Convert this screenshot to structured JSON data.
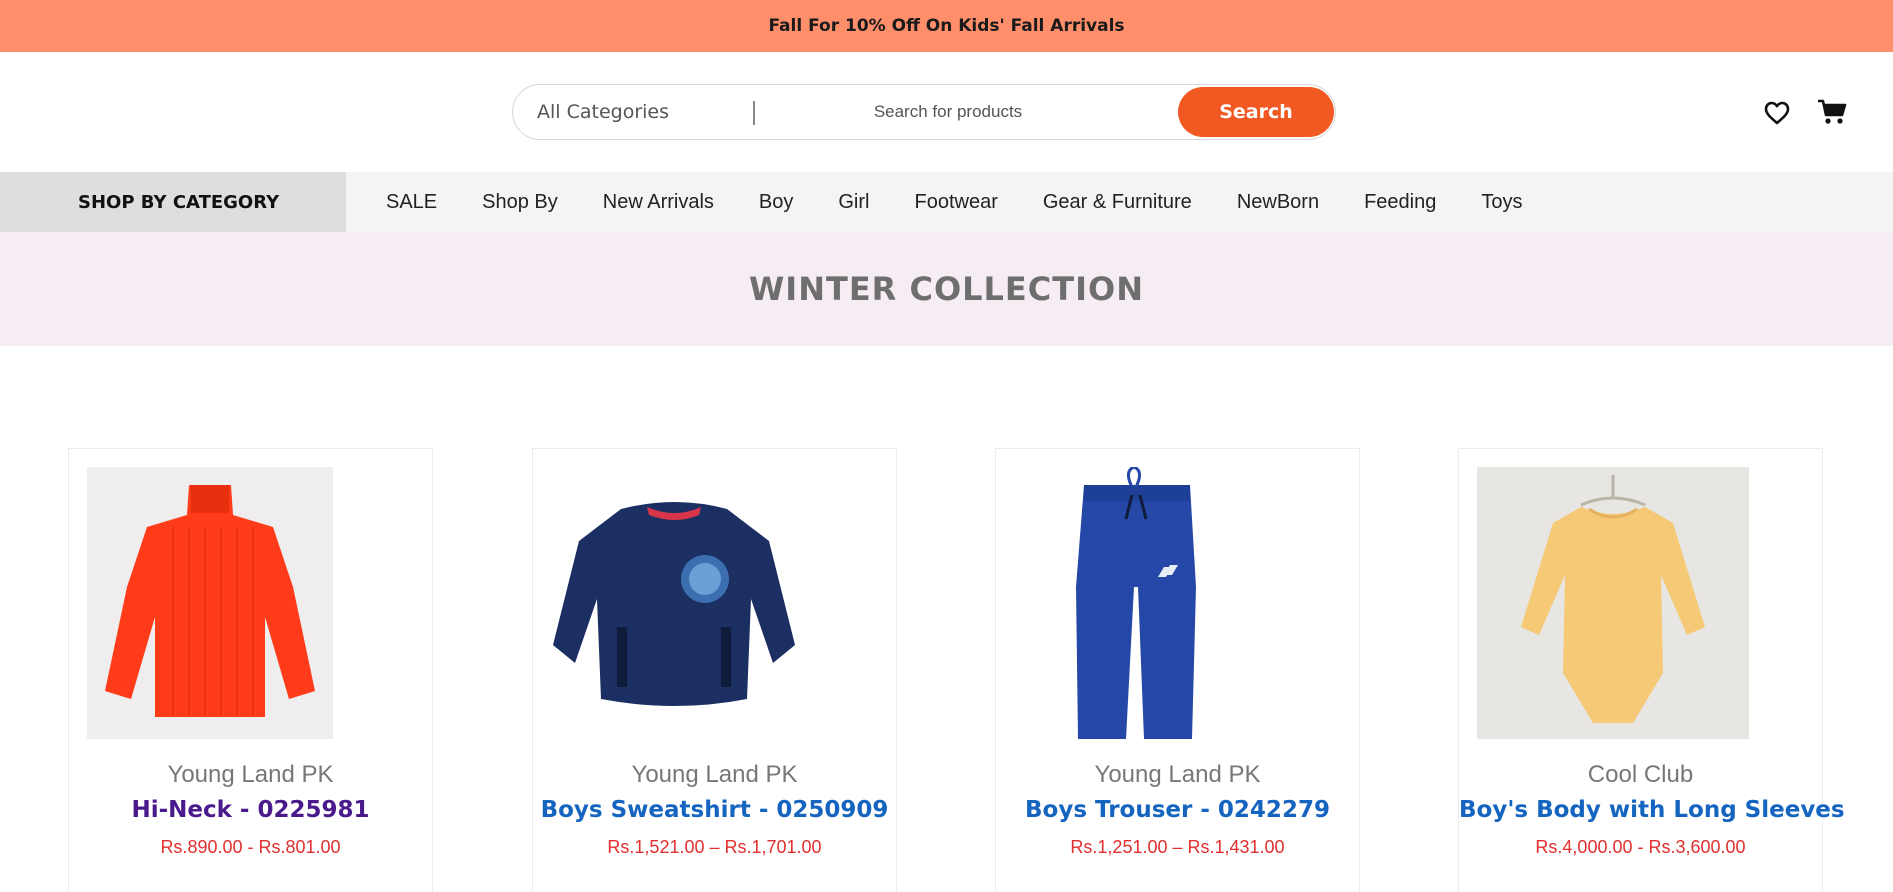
{
  "promo": {
    "text": "Fall For 10% Off On Kids' Fall Arrivals"
  },
  "search": {
    "category": "All Categories",
    "placeholder": "Search for products",
    "button_label": "Search"
  },
  "header_icons": [
    "heart-icon",
    "cart-icon"
  ],
  "nav": {
    "shop_by_category": "SHOP BY CATEGORY",
    "items": [
      {
        "label": "SALE"
      },
      {
        "label": "Shop By"
      },
      {
        "label": "New Arrivals"
      },
      {
        "label": "Boy"
      },
      {
        "label": "Girl"
      },
      {
        "label": "Footwear"
      },
      {
        "label": "Gear & Furniture"
      },
      {
        "label": "NewBorn"
      },
      {
        "label": "Feeding"
      },
      {
        "label": "Toys"
      }
    ]
  },
  "banner": {
    "title": "WINTER COLLECTION"
  },
  "products": [
    {
      "brand": "Young Land PK",
      "title": "Hi-Neck - 0225981",
      "price": "Rs.890.00 - Rs.801.00",
      "image": "orange-turtleneck-sweater"
    },
    {
      "brand": "Young Land PK",
      "title": "Boys Sweatshirt - 0250909",
      "price": "Rs.1,521.00 – Rs.1,701.00",
      "image": "navy-sweatshirt"
    },
    {
      "brand": "Young Land PK",
      "title": "Boys Trouser - 0242279",
      "price": "Rs.1,251.00 – Rs.1,431.00",
      "image": "blue-trouser"
    },
    {
      "brand": "Cool Club",
      "title": "Boy's Body with Long Sleeves",
      "price": "Rs.4,000.00 - Rs.3,600.00",
      "image": "yellow-bodysuit"
    }
  ],
  "colors": {
    "promo_bg": "#ff8f6a",
    "accent": "#f05a22",
    "link": "#1565c0",
    "visited_link": "#4a1a8c",
    "price": "#e02f2f",
    "banner_bg": "#f6ecf3"
  }
}
